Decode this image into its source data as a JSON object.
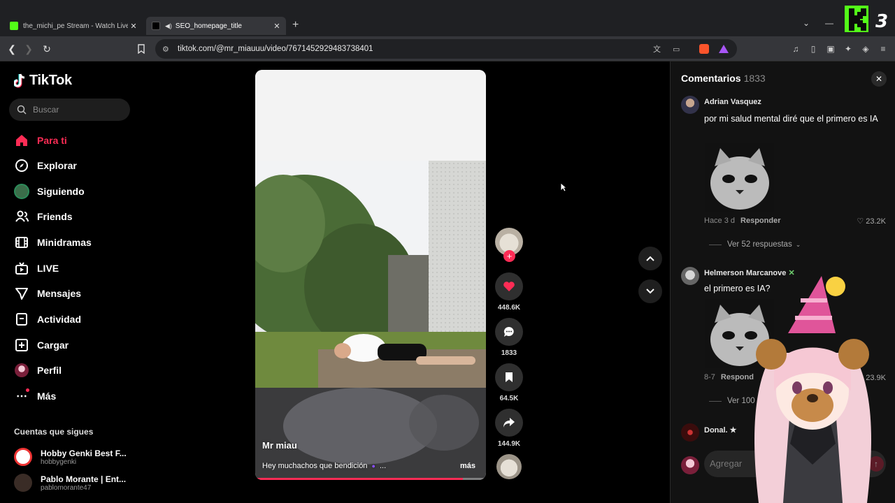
{
  "browser": {
    "tabs": [
      {
        "title": "the_michi_pe Stream - Watch Live on",
        "active": false
      },
      {
        "title": "SEO_homepage_title",
        "active": true
      }
    ],
    "url": "tiktok.com/@mr_miauuu/video/7671452929483738401"
  },
  "overlay_badge": {
    "text": "3"
  },
  "sidebar": {
    "logo": "TikTok",
    "search_placeholder": "Buscar",
    "nav": [
      {
        "label": "Para ti",
        "icon": "home-icon",
        "active": true
      },
      {
        "label": "Explorar",
        "icon": "compass-icon"
      },
      {
        "label": "Siguiendo",
        "icon": "following-avatar-icon"
      },
      {
        "label": "Friends",
        "icon": "friends-icon"
      },
      {
        "label": "Minidramas",
        "icon": "film-icon"
      },
      {
        "label": "LIVE",
        "icon": "live-tv-icon"
      },
      {
        "label": "Mensajes",
        "icon": "send-icon"
      },
      {
        "label": "Actividad",
        "icon": "inbox-icon"
      },
      {
        "label": "Cargar",
        "icon": "upload-plus-icon"
      },
      {
        "label": "Perfil",
        "icon": "profile-avatar-icon"
      },
      {
        "label": "Más",
        "icon": "more-dots-icon"
      }
    ],
    "following_title": "Cuentas que sigues",
    "following": [
      {
        "name": "Hobby Genki Best F...",
        "handle": "hobbygenki"
      },
      {
        "name": "Pablo Morante | Ent...",
        "handle": "pablomorante47"
      }
    ]
  },
  "video": {
    "author": "Mr miau",
    "description": "Hey muchachos que bendición",
    "ellipsis": "...",
    "more_label": "más",
    "progress": 0.9
  },
  "actions": {
    "likes": "448.6K",
    "comments": "1833",
    "saves": "64.5K",
    "shares": "144.9K"
  },
  "comments": {
    "title": "Comentarios",
    "count": "1833",
    "items": [
      {
        "user": "Adrian Vasquez",
        "text": "por mi salud mental diré que el primero es IA",
        "time": "Hace 3 d",
        "reply_label": "Responder",
        "likes": "23.2K",
        "view_replies": "Ver 52 respuestas"
      },
      {
        "user": "Helmerson Marcanove",
        "text": "el primero es IA?",
        "time": "8-7",
        "reply_label": "Respond",
        "likes": "23.9K",
        "view_replies": "Ver 100 r"
      },
      {
        "user": "Donal. ★"
      }
    ],
    "input_placeholder": "Agregar"
  },
  "colors": {
    "accent": "#fe2c55",
    "panel_bg": "#121212"
  }
}
